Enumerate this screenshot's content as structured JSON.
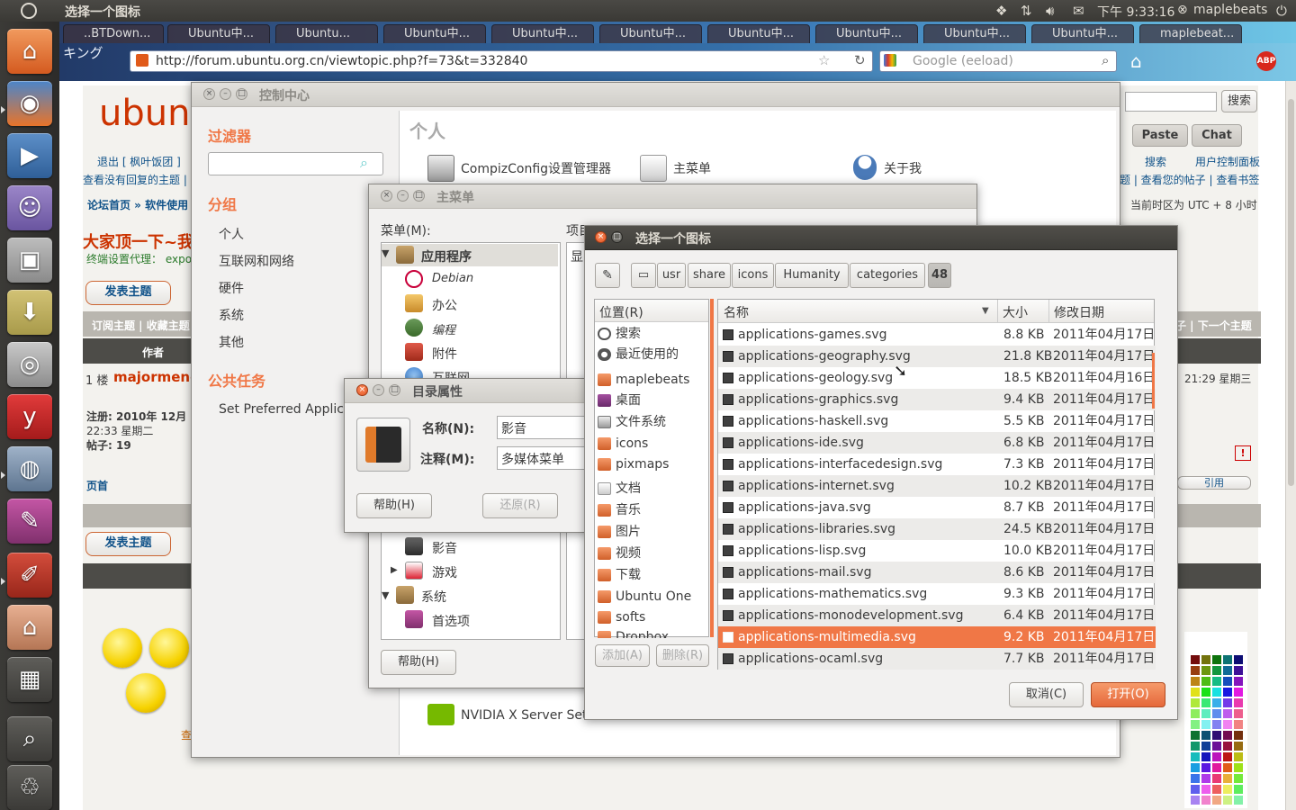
{
  "top_panel": {
    "window_title": "选择一个图标",
    "clock": "下午 9:33:16",
    "user": "maplebeats"
  },
  "browser": {
    "tabs": [
      "..BTDown...",
      "Ubuntu中...",
      "Ubuntu...",
      "Ubuntu中...",
      "Ubuntu中...",
      "Ubuntu中...",
      "Ubuntu中...",
      "Ubuntu中...",
      "Ubuntu中...",
      "Ubuntu中...",
      "maplebeat..."
    ],
    "url": "http://forum.ubuntu.org.cn/viewtopic.php?f=73&t=332840",
    "search_placeholder": "Google (eeload)",
    "tab_strip_text": "キング"
  },
  "forum": {
    "logo_text": "ubun",
    "search_button": "搜索",
    "paste_tab": "Paste",
    "chat_tab": "Chat",
    "logout": "退出 [ 枫叶饭团 ]",
    "unanswered": "查看没有回复的主题 |",
    "search_link": "搜索",
    "user_cp": "用户控制面板",
    "my_posts": "题 | 查看您的帖子 | 查看书签",
    "breadcrumb": "论坛首页 » 软件使用",
    "timezone": "当前时区为 UTC + 8 小时",
    "topic_title": "大家顶一下~我",
    "proxy_text": "终端设置代理： expo",
    "post_topic": "发表主题",
    "subscribe": "订阅主题 | 收藏主题",
    "next_topic": "子 | 下一个主题",
    "author_header": "作者",
    "floor": "1 楼",
    "author": "majormeng",
    "post_time": "21:29 星期三",
    "reg_date": "注册: 2010年 12月",
    "reg_time": "22:33 星期二",
    "post_count": "帖子: 19",
    "top_link": "页首",
    "quote": "引用",
    "view_link": "查"
  },
  "control_center": {
    "title": "控制中心",
    "filter_heading": "过滤器",
    "group_heading": "分组",
    "groups": [
      "个人",
      "互联网和网络",
      "硬件",
      "系统",
      "其他"
    ],
    "tasks_heading": "公共任务",
    "task": "Set Preferred Applica",
    "section": "个人",
    "items": [
      "CompizConfig设置管理器",
      "主菜单",
      "关于我"
    ],
    "nvidia": "NVIDIA X Server Sett"
  },
  "main_menu": {
    "title": "主菜单",
    "menu_label": "菜单(M):",
    "items_label": "项目(I):",
    "col_show": "显",
    "tree": [
      "应用程序",
      "Debian",
      "办公",
      "编程",
      "附件",
      "互联网",
      "影音",
      "游戏",
      "系统",
      "首选项"
    ],
    "help": "帮助(H)"
  },
  "dir_props": {
    "title": "目录属性",
    "name_label": "名称(N):",
    "name_value": "影音",
    "comment_label": "注释(M):",
    "comment_value": "多媒体菜单",
    "help": "帮助(H)",
    "revert": "还原(R)"
  },
  "chooser": {
    "title": "选择一个图标",
    "path": [
      "usr",
      "share",
      "icons",
      "Humanity",
      "categories",
      "48"
    ],
    "places_header": "位置(R)",
    "places": [
      "搜索",
      "最近使用的",
      "maplebeats",
      "桌面",
      "文件系统",
      "icons",
      "pixmaps",
      "文档",
      "音乐",
      "图片",
      "视频",
      "下载",
      "Ubuntu One",
      "softs",
      "Dropbox"
    ],
    "add": "添加(A)",
    "remove": "删除(R)",
    "col_name": "名称",
    "col_size": "大小",
    "col_date": "修改日期",
    "files": [
      {
        "name": "applications-games.svg",
        "size": "8.8 KB",
        "date": "2011年04月17日"
      },
      {
        "name": "applications-geography.svg",
        "size": "21.8 KB",
        "date": "2011年04月17日"
      },
      {
        "name": "applications-geology.svg",
        "size": "18.5 KB",
        "date": "2011年04月16日"
      },
      {
        "name": "applications-graphics.svg",
        "size": "9.4 KB",
        "date": "2011年04月17日"
      },
      {
        "name": "applications-haskell.svg",
        "size": "5.5 KB",
        "date": "2011年04月17日"
      },
      {
        "name": "applications-ide.svg",
        "size": "6.8 KB",
        "date": "2011年04月17日"
      },
      {
        "name": "applications-interfacedesign.svg",
        "size": "7.3 KB",
        "date": "2011年04月17日"
      },
      {
        "name": "applications-internet.svg",
        "size": "10.2 KB",
        "date": "2011年04月17日"
      },
      {
        "name": "applications-java.svg",
        "size": "8.7 KB",
        "date": "2011年04月17日"
      },
      {
        "name": "applications-libraries.svg",
        "size": "24.5 KB",
        "date": "2011年04月17日"
      },
      {
        "name": "applications-lisp.svg",
        "size": "10.0 KB",
        "date": "2011年04月17日"
      },
      {
        "name": "applications-mail.svg",
        "size": "8.6 KB",
        "date": "2011年04月17日"
      },
      {
        "name": "applications-mathematics.svg",
        "size": "9.3 KB",
        "date": "2011年04月17日"
      },
      {
        "name": "applications-monodevelopment.svg",
        "size": "6.4 KB",
        "date": "2011年04月17日"
      },
      {
        "name": "applications-multimedia.svg",
        "size": "9.2 KB",
        "date": "2011年04月17日"
      },
      {
        "name": "applications-ocaml.svg",
        "size": "7.7 KB",
        "date": "2011年04月17日"
      }
    ],
    "selected": "applications-multimedia.svg",
    "cancel": "取消(C)",
    "open": "打开(O)"
  },
  "colors": {
    "ubuntu_orange": "#f07746",
    "panel_bg": "#3c3b37",
    "window_bg": "#f2f1f0",
    "forum_red": "#cc3300"
  },
  "icons": [
    "ubuntu-logo-icon",
    "dropbox-icon",
    "network-icon",
    "volume-icon",
    "mail-icon",
    "power-icon"
  ]
}
